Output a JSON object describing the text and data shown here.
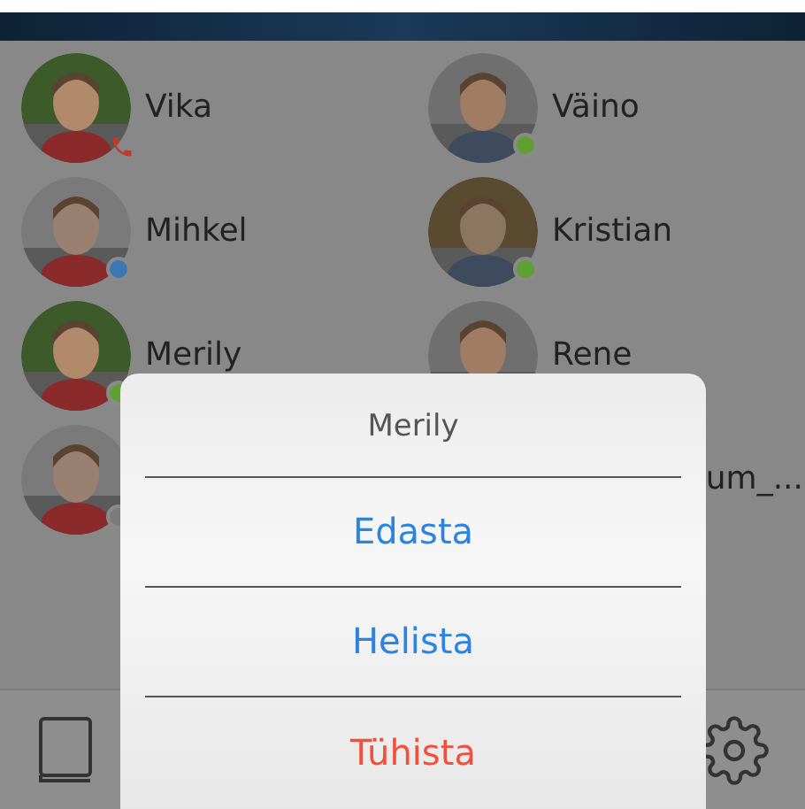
{
  "contacts": [
    {
      "name": "Vika",
      "status": {
        "kind": "call",
        "color": "#c0392b"
      }
    },
    {
      "name": "Väino",
      "status": {
        "kind": "dot",
        "color": "#5fa032"
      }
    },
    {
      "name": "Mihkel",
      "status": {
        "kind": "dot",
        "color": "#3a78b5"
      }
    },
    {
      "name": "Kristian",
      "status": {
        "kind": "dot",
        "color": "#5fa032"
      }
    },
    {
      "name": "Merily",
      "status": {
        "kind": "dot",
        "color": "#5fa032"
      }
    },
    {
      "name": "Rene"
    },
    {
      "status": {
        "kind": "dot",
        "color": "#7a7a7a"
      }
    },
    {
      "name": "um_...",
      "partial": true
    }
  ],
  "dialog": {
    "title": "Merily",
    "actions": [
      {
        "label": "Edasta",
        "kind": "default"
      },
      {
        "label": "Helista",
        "kind": "default"
      },
      {
        "label": "Tühista",
        "kind": "destructive"
      }
    ]
  }
}
